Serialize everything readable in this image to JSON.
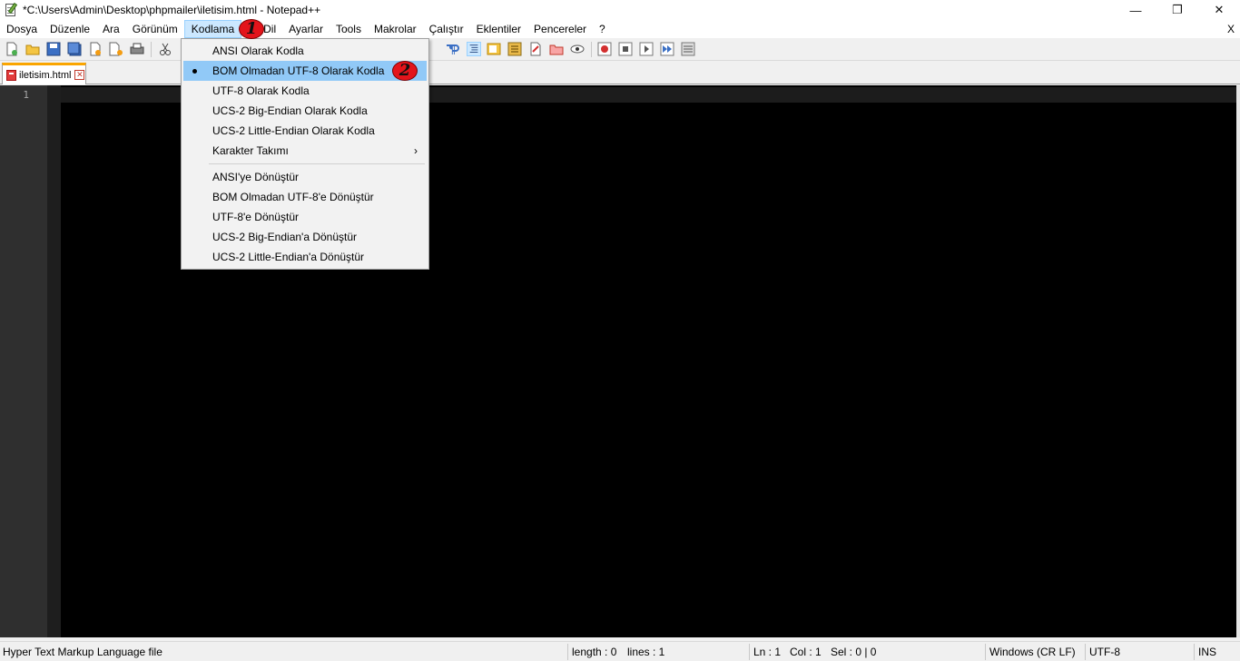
{
  "window": {
    "title": "*C:\\Users\\Admin\\Desktop\\phpmailer\\iletisim.html - Notepad++",
    "controls": {
      "minimize": "—",
      "maximize": "❐",
      "close": "✕"
    }
  },
  "menubar": {
    "items": [
      "Dosya",
      "Düzenle",
      "Ara",
      "Görünüm",
      "Kodlama",
      "Dil",
      "Ayarlar",
      "Tools",
      "Makrolar",
      "Çalıştır",
      "Eklentiler",
      "Pencereler",
      "?"
    ],
    "active": "Kodlama",
    "close_label": "X"
  },
  "tab": {
    "label": "iletisim.html"
  },
  "editor": {
    "line_numbers": [
      "1"
    ],
    "theme_background": "#000000"
  },
  "dropdown": {
    "items": [
      {
        "label": "ANSI Olarak Kodla"
      },
      {
        "label": "BOM Olmadan UTF-8 Olarak Kodla",
        "selected": true,
        "highlighted": true
      },
      {
        "label": "UTF-8 Olarak Kodla"
      },
      {
        "label": "UCS-2 Big-Endian Olarak Kodla"
      },
      {
        "label": "UCS-2 Little-Endian Olarak Kodla"
      },
      {
        "label": "Karakter Takımı",
        "submenu": true,
        "arrow": "›"
      },
      {
        "label": "ANSI'ye Dönüştür"
      },
      {
        "label": "BOM Olmadan UTF-8'e Dönüştür"
      },
      {
        "label": "UTF-8'e Dönüştür"
      },
      {
        "label": "UCS-2 Big-Endian'a Dönüştür"
      },
      {
        "label": "UCS-2 Little-Endian'a Dönüştür"
      }
    ]
  },
  "annotations": {
    "step1": "1",
    "step2": "2",
    "color": "#e3141b"
  },
  "statusbar": {
    "file_type": "Hyper Text Markup Language file",
    "length": "length : 0",
    "lines": "lines : 1",
    "ln": "Ln : 1",
    "col": "Col : 1",
    "sel": "Sel : 0 | 0",
    "eol": "Windows (CR LF)",
    "encoding": "UTF-8",
    "mode": "INS"
  }
}
